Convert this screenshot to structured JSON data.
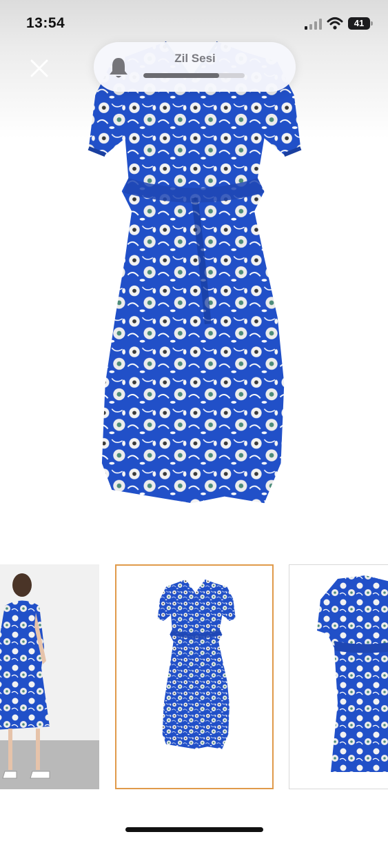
{
  "status_bar": {
    "time": "13:54",
    "battery": "41",
    "icons": [
      "cellular-signal-icon",
      "wifi-icon",
      "battery-icon"
    ]
  },
  "volume_hud": {
    "title": "Zil Sesi",
    "icon": "bell-icon",
    "level_fraction": 0.75
  },
  "gallery": {
    "close_icon": "close-icon",
    "selected_index": 1,
    "thumbnail_count": 3
  },
  "colors": {
    "dress_blue": "#1f4fc4",
    "selected_border": "#e09a4a"
  }
}
